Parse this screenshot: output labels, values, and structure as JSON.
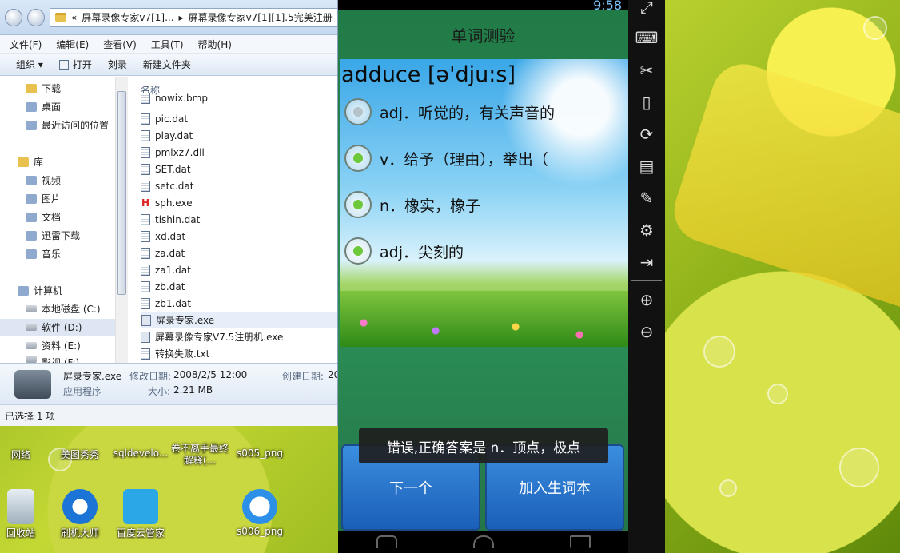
{
  "explorer": {
    "address_parts": [
      "«",
      "屏幕录像专家v7[1]...",
      "▸",
      "屏幕录像专家v7[1][1].5完美注册"
    ],
    "menu": [
      "文件(F)",
      "编辑(E)",
      "查看(V)",
      "工具(T)",
      "帮助(H)"
    ],
    "toolbar": {
      "organize": "组织 ▾",
      "open": "打开",
      "burn": "刻录",
      "new_folder": "新建文件夹"
    },
    "nav_items": [
      {
        "label": "下载",
        "icon": "downloads-folder-icon"
      },
      {
        "label": "桌面",
        "icon": "desktop-icon"
      },
      {
        "label": "最近访问的位置",
        "icon": "recent-places-icon"
      },
      {
        "label": "库",
        "icon": "libraries-icon"
      },
      {
        "label": "视频",
        "icon": "videos-library-icon"
      },
      {
        "label": "图片",
        "icon": "pictures-library-icon"
      },
      {
        "label": "文档",
        "icon": "documents-library-icon"
      },
      {
        "label": "迅雷下载",
        "icon": "thunder-download-icon"
      },
      {
        "label": "音乐",
        "icon": "music-library-icon"
      },
      {
        "label": "计算机",
        "icon": "computer-icon"
      },
      {
        "label": "本地磁盘 (C:)",
        "icon": "drive-c-icon"
      },
      {
        "label": "软件 (D:)",
        "icon": "drive-d-icon"
      },
      {
        "label": "资料 (E:)",
        "icon": "drive-e-icon"
      },
      {
        "label": "影视 (F:)",
        "icon": "drive-f-icon"
      }
    ],
    "column_name": "名称",
    "files": [
      "nowix.bmp",
      "pic.dat",
      "play.dat",
      "pmlxz7.dll",
      "SET.dat",
      "setc.dat",
      "sph.exe",
      "tishin.dat",
      "xd.dat",
      "za.dat",
      "za1.dat",
      "zb.dat",
      "zb1.dat",
      "屏录专家.exe",
      "屏幕录像专家V7.5注册机.exe",
      "转换失败.txt"
    ],
    "details": {
      "name": "屏录专家.exe",
      "type": "应用程序",
      "modified_label": "修改日期:",
      "modified": "2008/2/5 12:00",
      "size_label": "大小:",
      "size": "2.21 MB",
      "created_label": "创建日期:",
      "created": "20"
    },
    "status": "已选择 1 项"
  },
  "desktop_icons": [
    {
      "label": "网络"
    },
    {
      "label": "美图秀秀"
    },
    {
      "label": "sqldevelo..."
    },
    {
      "label": "卷不离手最终解释(..."
    },
    {
      "label": "s005_png"
    },
    {
      "label": "回收站"
    },
    {
      "label": "刷机大师"
    },
    {
      "label": "百度云管家"
    },
    {
      "label": "s006_png"
    }
  ],
  "phone": {
    "clock": "9:58",
    "app_title": "单词测验",
    "word": "adduce [ə'dju:s]",
    "options": [
      "adj．听觉的，有关声音的",
      "v．给予（理由），举出（",
      "n．橡实，橡子",
      "adj．尖刻的"
    ],
    "toast": "错误,正确答案是 n．顶点，极点",
    "next_button": "下一个",
    "add_vocab_button": "加入生词本"
  },
  "emulator_toolbar": [
    "fullscreen-icon",
    "keyboard-icon",
    "scissors-icon",
    "shake-icon",
    "rotate-icon",
    "apk-install-icon",
    "clean-brush-icon",
    "settings-gear-icon",
    "exit-icon",
    "volume-up-icon",
    "volume-down-icon"
  ]
}
